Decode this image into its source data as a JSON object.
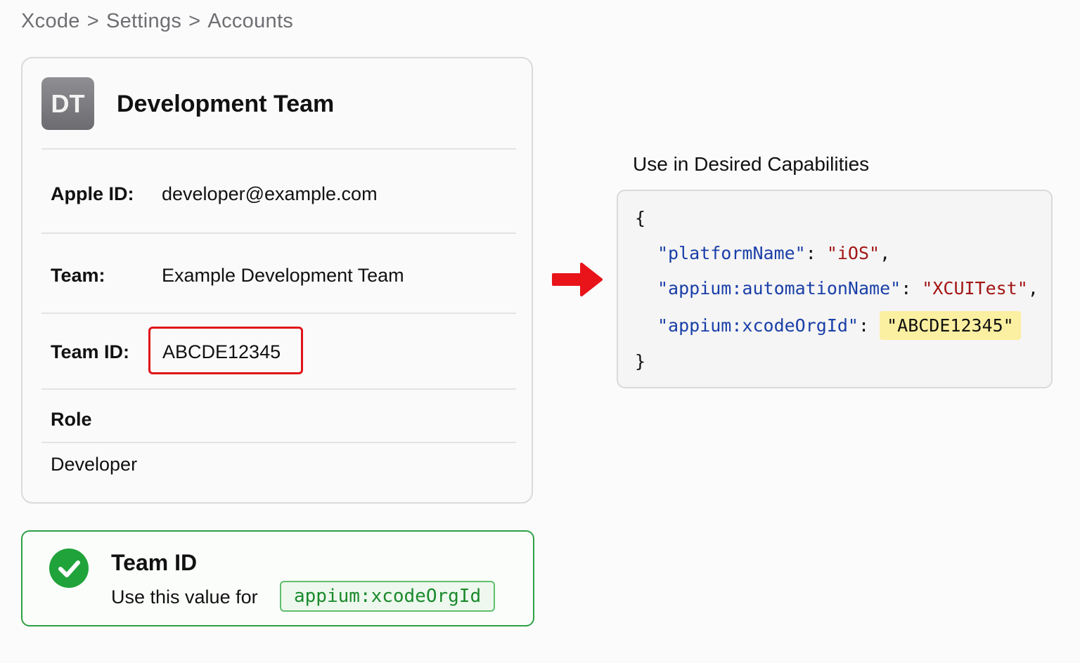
{
  "breadcrumb": {
    "items": [
      "Xcode",
      "Settings",
      "Accounts"
    ],
    "separator": ">"
  },
  "account": {
    "avatar_initials": "DT",
    "team_name": "Development Team",
    "apple_id_label": "Apple ID:",
    "apple_id_value": "developer@example.com",
    "team_label": "Team:",
    "team_value": "Example Development Team",
    "team_id_label": "Team ID:",
    "team_id_value": "ABCDE12345",
    "role_label": "Role",
    "role_value": "Developer"
  },
  "success": {
    "title": "Team ID",
    "text": "Use this value for",
    "code": "appium:xcodeOrgId",
    "icon": "checkmark-circle-icon"
  },
  "capabilities": {
    "title": "Use in Desired Capabilities",
    "open_brace": "{",
    "close_brace": "}",
    "lines": [
      {
        "key": "\"platformName\"",
        "colon": ": ",
        "value": "\"iOS\"",
        "comma": ","
      },
      {
        "key": "\"appium:automationName\"",
        "colon": ": ",
        "value": "\"XCUITest\"",
        "comma": ","
      },
      {
        "key": "\"appium:xcodeOrgId\"",
        "colon": ": ",
        "value": "\"ABCDE12345\"",
        "comma": ""
      }
    ]
  },
  "colors": {
    "highlight_red": "#e0141a",
    "success_green": "#20a33a",
    "json_key_blue": "#1a3fa8",
    "json_string_red": "#a31515",
    "highlight_yellow": "#fbefa1"
  },
  "arrow_icon": "right-arrow-icon"
}
